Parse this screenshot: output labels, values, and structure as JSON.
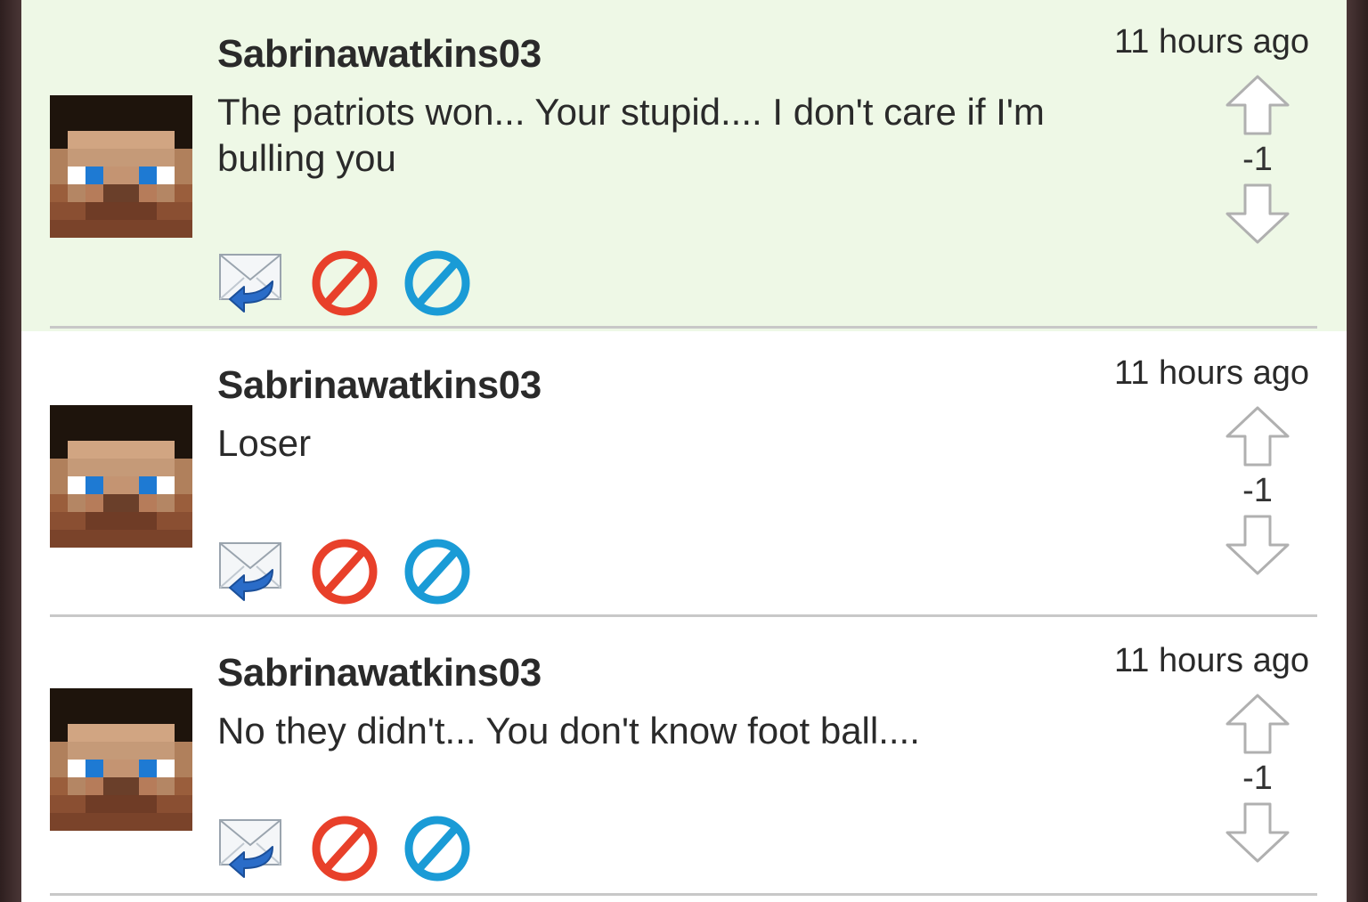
{
  "comments": [
    {
      "username": "Sabrinawatkins03",
      "message": "The patriots won... Your stupid.... I don't care if I'm bulling you",
      "timestamp": "11 hours ago",
      "score": "-1",
      "highlighted": true
    },
    {
      "username": "Sabrinawatkins03",
      "message": "Loser",
      "timestamp": "11 hours ago",
      "score": "-1",
      "highlighted": false
    },
    {
      "username": "Sabrinawatkins03",
      "message": "No they didn't... You don't know foot ball....",
      "timestamp": "11 hours ago",
      "score": "-1",
      "highlighted": false
    }
  ],
  "icons": {
    "avatar": "pixel-face-icon",
    "reply": "mail-reply-icon",
    "report": "red-block-icon",
    "ignore": "blue-block-icon",
    "upvote": "up-arrow-icon",
    "downvote": "down-arrow-icon"
  },
  "colors": {
    "highlight_bg": "#eef8e6",
    "report_red": "#e8402a",
    "ignore_blue": "#1a9bd6",
    "divider": "#c8c8c8"
  }
}
